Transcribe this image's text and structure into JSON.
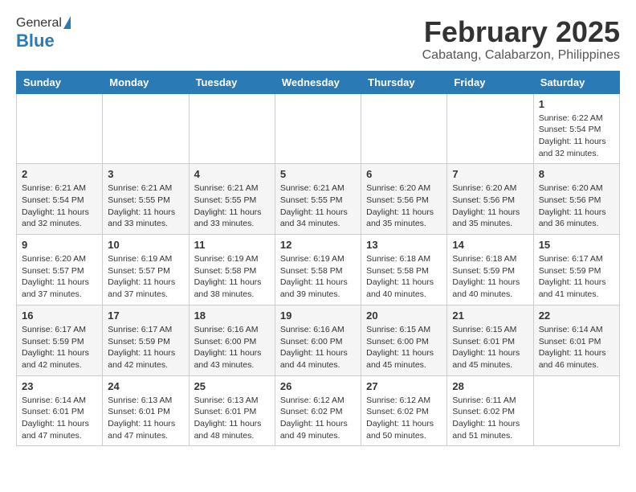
{
  "header": {
    "logo_general": "General",
    "logo_blue": "Blue",
    "month": "February 2025",
    "location": "Cabatang, Calabarzon, Philippines"
  },
  "weekdays": [
    "Sunday",
    "Monday",
    "Tuesday",
    "Wednesday",
    "Thursday",
    "Friday",
    "Saturday"
  ],
  "weeks": [
    [
      null,
      null,
      null,
      null,
      null,
      null,
      {
        "day": "1",
        "sunrise": "Sunrise: 6:22 AM",
        "sunset": "Sunset: 5:54 PM",
        "daylight": "Daylight: 11 hours and 32 minutes."
      }
    ],
    [
      {
        "day": "2",
        "sunrise": "Sunrise: 6:21 AM",
        "sunset": "Sunset: 5:54 PM",
        "daylight": "Daylight: 11 hours and 32 minutes."
      },
      {
        "day": "3",
        "sunrise": "Sunrise: 6:21 AM",
        "sunset": "Sunset: 5:55 PM",
        "daylight": "Daylight: 11 hours and 33 minutes."
      },
      {
        "day": "4",
        "sunrise": "Sunrise: 6:21 AM",
        "sunset": "Sunset: 5:55 PM",
        "daylight": "Daylight: 11 hours and 33 minutes."
      },
      {
        "day": "5",
        "sunrise": "Sunrise: 6:21 AM",
        "sunset": "Sunset: 5:55 PM",
        "daylight": "Daylight: 11 hours and 34 minutes."
      },
      {
        "day": "6",
        "sunrise": "Sunrise: 6:20 AM",
        "sunset": "Sunset: 5:56 PM",
        "daylight": "Daylight: 11 hours and 35 minutes."
      },
      {
        "day": "7",
        "sunrise": "Sunrise: 6:20 AM",
        "sunset": "Sunset: 5:56 PM",
        "daylight": "Daylight: 11 hours and 35 minutes."
      },
      {
        "day": "8",
        "sunrise": "Sunrise: 6:20 AM",
        "sunset": "Sunset: 5:56 PM",
        "daylight": "Daylight: 11 hours and 36 minutes."
      }
    ],
    [
      {
        "day": "9",
        "sunrise": "Sunrise: 6:20 AM",
        "sunset": "Sunset: 5:57 PM",
        "daylight": "Daylight: 11 hours and 37 minutes."
      },
      {
        "day": "10",
        "sunrise": "Sunrise: 6:19 AM",
        "sunset": "Sunset: 5:57 PM",
        "daylight": "Daylight: 11 hours and 37 minutes."
      },
      {
        "day": "11",
        "sunrise": "Sunrise: 6:19 AM",
        "sunset": "Sunset: 5:58 PM",
        "daylight": "Daylight: 11 hours and 38 minutes."
      },
      {
        "day": "12",
        "sunrise": "Sunrise: 6:19 AM",
        "sunset": "Sunset: 5:58 PM",
        "daylight": "Daylight: 11 hours and 39 minutes."
      },
      {
        "day": "13",
        "sunrise": "Sunrise: 6:18 AM",
        "sunset": "Sunset: 5:58 PM",
        "daylight": "Daylight: 11 hours and 40 minutes."
      },
      {
        "day": "14",
        "sunrise": "Sunrise: 6:18 AM",
        "sunset": "Sunset: 5:59 PM",
        "daylight": "Daylight: 11 hours and 40 minutes."
      },
      {
        "day": "15",
        "sunrise": "Sunrise: 6:17 AM",
        "sunset": "Sunset: 5:59 PM",
        "daylight": "Daylight: 11 hours and 41 minutes."
      }
    ],
    [
      {
        "day": "16",
        "sunrise": "Sunrise: 6:17 AM",
        "sunset": "Sunset: 5:59 PM",
        "daylight": "Daylight: 11 hours and 42 minutes."
      },
      {
        "day": "17",
        "sunrise": "Sunrise: 6:17 AM",
        "sunset": "Sunset: 5:59 PM",
        "daylight": "Daylight: 11 hours and 42 minutes."
      },
      {
        "day": "18",
        "sunrise": "Sunrise: 6:16 AM",
        "sunset": "Sunset: 6:00 PM",
        "daylight": "Daylight: 11 hours and 43 minutes."
      },
      {
        "day": "19",
        "sunrise": "Sunrise: 6:16 AM",
        "sunset": "Sunset: 6:00 PM",
        "daylight": "Daylight: 11 hours and 44 minutes."
      },
      {
        "day": "20",
        "sunrise": "Sunrise: 6:15 AM",
        "sunset": "Sunset: 6:00 PM",
        "daylight": "Daylight: 11 hours and 45 minutes."
      },
      {
        "day": "21",
        "sunrise": "Sunrise: 6:15 AM",
        "sunset": "Sunset: 6:01 PM",
        "daylight": "Daylight: 11 hours and 45 minutes."
      },
      {
        "day": "22",
        "sunrise": "Sunrise: 6:14 AM",
        "sunset": "Sunset: 6:01 PM",
        "daylight": "Daylight: 11 hours and 46 minutes."
      }
    ],
    [
      {
        "day": "23",
        "sunrise": "Sunrise: 6:14 AM",
        "sunset": "Sunset: 6:01 PM",
        "daylight": "Daylight: 11 hours and 47 minutes."
      },
      {
        "day": "24",
        "sunrise": "Sunrise: 6:13 AM",
        "sunset": "Sunset: 6:01 PM",
        "daylight": "Daylight: 11 hours and 47 minutes."
      },
      {
        "day": "25",
        "sunrise": "Sunrise: 6:13 AM",
        "sunset": "Sunset: 6:01 PM",
        "daylight": "Daylight: 11 hours and 48 minutes."
      },
      {
        "day": "26",
        "sunrise": "Sunrise: 6:12 AM",
        "sunset": "Sunset: 6:02 PM",
        "daylight": "Daylight: 11 hours and 49 minutes."
      },
      {
        "day": "27",
        "sunrise": "Sunrise: 6:12 AM",
        "sunset": "Sunset: 6:02 PM",
        "daylight": "Daylight: 11 hours and 50 minutes."
      },
      {
        "day": "28",
        "sunrise": "Sunrise: 6:11 AM",
        "sunset": "Sunset: 6:02 PM",
        "daylight": "Daylight: 11 hours and 51 minutes."
      },
      null
    ]
  ]
}
